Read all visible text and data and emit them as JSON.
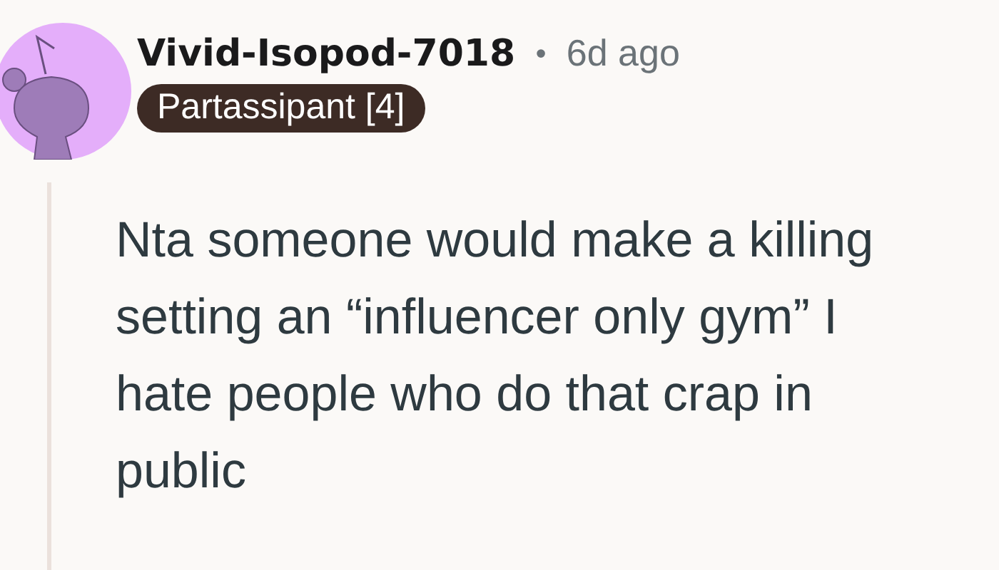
{
  "comment": {
    "author": "Vivid-Isopod-7018",
    "separator": "•",
    "time": "6d ago",
    "flair": "Partassipant [4]",
    "body": "Nta someone would make a killing setting an “influencer only gym” I hate people who do that crap in public"
  }
}
